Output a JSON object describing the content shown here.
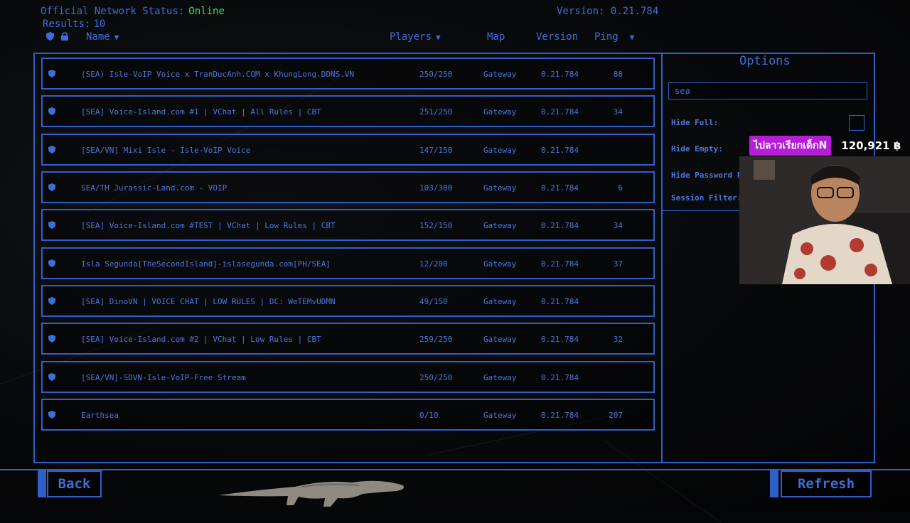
{
  "status": {
    "label": "Official Network Status:",
    "value": "Online",
    "results_label": "Results:",
    "results_count": "10",
    "version": "Version: 0.21.784"
  },
  "columns": {
    "name": "Name",
    "players": "Players",
    "map": "Map",
    "version": "Version",
    "ping": "Ping"
  },
  "servers": [
    {
      "name": "(SEA) Isle-VoIP Voice x TranDucAnh.COM x KhungLong.DDNS.VN",
      "players": "250/250",
      "map": "Gateway",
      "version": "0.21.784",
      "ping": "88"
    },
    {
      "name": "[SEA] Voice-Island.com #1 | VChat | All Rules | CBT",
      "players": "251/250",
      "map": "Gateway",
      "version": "0.21.784",
      "ping": "34"
    },
    {
      "name": "[SEA/VN] Mixi Isle - Isle-VoIP Voice",
      "players": "147/150",
      "map": "Gateway",
      "version": "0.21.784",
      "ping": ""
    },
    {
      "name": "SEA/TH Jurassic-Land.com - VOIP",
      "players": "103/300",
      "map": "Gateway",
      "version": "0.21.784",
      "ping": "6"
    },
    {
      "name": "[SEA] Voice-Island.com #TEST | VChat | Low Rules | CBT",
      "players": "152/150",
      "map": "Gateway",
      "version": "0.21.784",
      "ping": "34"
    },
    {
      "name": "Isla Segunda[TheSecondIsland]-islasegunda.com[PH/SEA]",
      "players": "12/200",
      "map": "Gateway",
      "version": "0.21.784",
      "ping": "37"
    },
    {
      "name": "[SEA] DinoVN | VOICE CHAT | LOW RULES | DC: WeTEMvUDMN",
      "players": "49/150",
      "map": "Gateway",
      "version": "0.21.784",
      "ping": ""
    },
    {
      "name": "[SEA] Voice-Island.com #2 | VChat | Low Rules | CBT",
      "players": "259/250",
      "map": "Gateway",
      "version": "0.21.784",
      "ping": "32"
    },
    {
      "name": "[SEA/VN]-SDVN-Isle-VoIP-Free Stream",
      "players": "250/250",
      "map": "Gateway",
      "version": "0.21.784",
      "ping": ""
    },
    {
      "name": "Earthsea",
      "players": "0/10",
      "map": "Gateway",
      "version": "0.21.784",
      "ping": "207"
    }
  ],
  "options": {
    "title": "Options",
    "search_value": "sea",
    "hide_full": "Hide Full:",
    "hide_empty": "Hide Empty:",
    "hide_password": "Hide Password P",
    "session_filter": "Session Filter:"
  },
  "buttons": {
    "back": "Back",
    "refresh": "Refresh"
  },
  "overlay": {
    "donation_name": "ไปลาวเรียกเด็กN",
    "donation_amount": "120,921 ฿"
  },
  "colors": {
    "accent": "#2f5fc8",
    "text": "#3d6ed8",
    "online": "#3fe04a",
    "donation": "#b51ed6"
  }
}
